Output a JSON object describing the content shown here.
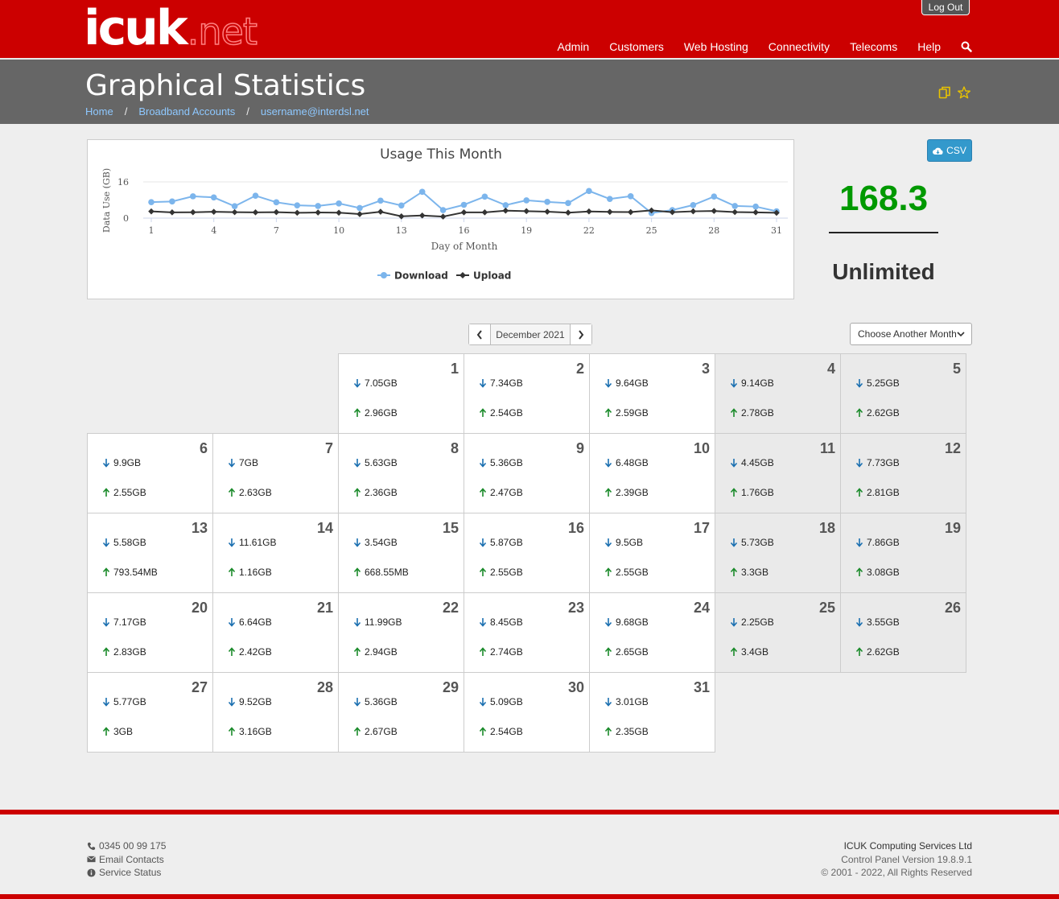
{
  "header": {
    "logo_main": "icuk",
    "logo_suffix": ".net",
    "logout": "Log Out",
    "nav": [
      "Admin",
      "Customers",
      "Web Hosting",
      "Connectivity",
      "Telecoms",
      "Help"
    ],
    "search_icon": "search-icon"
  },
  "title_bar": {
    "title": "Graphical Statistics",
    "breadcrumbs": [
      "Home",
      "Broadband Accounts",
      "username@interdsl.net"
    ]
  },
  "colors": {
    "brand_red": "#cc0000",
    "download": "#7cb5ec",
    "upload": "#333333",
    "total": "#009900"
  },
  "chart_data": {
    "type": "line",
    "title": "Usage This Month",
    "xlabel": "Day of Month",
    "ylabel": "Data Use (GB)",
    "ylim": [
      0,
      16
    ],
    "y_ticks": [
      "0",
      "16"
    ],
    "x_ticks": [
      1,
      4,
      7,
      10,
      13,
      16,
      19,
      22,
      25,
      28,
      31
    ],
    "x": [
      1,
      2,
      3,
      4,
      5,
      6,
      7,
      8,
      9,
      10,
      11,
      12,
      13,
      14,
      15,
      16,
      17,
      18,
      19,
      20,
      21,
      22,
      23,
      24,
      25,
      26,
      27,
      28,
      29,
      30,
      31
    ],
    "series": [
      {
        "name": "Download",
        "values": [
          7.05,
          7.34,
          9.64,
          9.14,
          5.25,
          9.9,
          7,
          5.63,
          5.36,
          6.48,
          4.45,
          7.73,
          5.58,
          11.61,
          3.54,
          5.87,
          9.5,
          5.73,
          7.86,
          7.17,
          6.64,
          11.99,
          8.45,
          9.68,
          2.25,
          3.55,
          5.77,
          9.52,
          5.36,
          5.09,
          3.01
        ]
      },
      {
        "name": "Upload",
        "values": [
          2.96,
          2.54,
          2.59,
          2.78,
          2.62,
          2.55,
          2.63,
          2.36,
          2.47,
          2.39,
          1.76,
          2.81,
          0.79,
          1.16,
          0.67,
          2.55,
          2.55,
          3.3,
          3.08,
          2.83,
          2.42,
          2.94,
          2.74,
          2.65,
          3.4,
          2.62,
          3,
          3.16,
          2.67,
          2.54,
          2.35
        ]
      }
    ],
    "legend": "bottom-center"
  },
  "summary": {
    "csv_label": "CSV",
    "total": "168.3",
    "allowance": "Unlimited"
  },
  "month_nav": {
    "current": "December 2021",
    "select_label": "Choose Another Month"
  },
  "calendar": {
    "days": [
      {
        "day": "1",
        "down": "7.05GB",
        "up": "2.96GB"
      },
      {
        "day": "2",
        "down": "7.34GB",
        "up": "2.54GB"
      },
      {
        "day": "3",
        "down": "9.64GB",
        "up": "2.59GB"
      },
      {
        "day": "4",
        "down": "9.14GB",
        "up": "2.78GB"
      },
      {
        "day": "5",
        "down": "5.25GB",
        "up": "2.62GB"
      },
      {
        "day": "6",
        "down": "9.9GB",
        "up": "2.55GB"
      },
      {
        "day": "7",
        "down": "7GB",
        "up": "2.63GB"
      },
      {
        "day": "8",
        "down": "5.63GB",
        "up": "2.36GB"
      },
      {
        "day": "9",
        "down": "5.36GB",
        "up": "2.47GB"
      },
      {
        "day": "10",
        "down": "6.48GB",
        "up": "2.39GB"
      },
      {
        "day": "11",
        "down": "4.45GB",
        "up": "1.76GB"
      },
      {
        "day": "12",
        "down": "7.73GB",
        "up": "2.81GB"
      },
      {
        "day": "13",
        "down": "5.58GB",
        "up": "793.54MB"
      },
      {
        "day": "14",
        "down": "11.61GB",
        "up": "1.16GB"
      },
      {
        "day": "15",
        "down": "3.54GB",
        "up": "668.55MB"
      },
      {
        "day": "16",
        "down": "5.87GB",
        "up": "2.55GB"
      },
      {
        "day": "17",
        "down": "9.5GB",
        "up": "2.55GB"
      },
      {
        "day": "18",
        "down": "5.73GB",
        "up": "3.3GB"
      },
      {
        "day": "19",
        "down": "7.86GB",
        "up": "3.08GB"
      },
      {
        "day": "20",
        "down": "7.17GB",
        "up": "2.83GB"
      },
      {
        "day": "21",
        "down": "6.64GB",
        "up": "2.42GB"
      },
      {
        "day": "22",
        "down": "11.99GB",
        "up": "2.94GB"
      },
      {
        "day": "23",
        "down": "8.45GB",
        "up": "2.74GB"
      },
      {
        "day": "24",
        "down": "9.68GB",
        "up": "2.65GB"
      },
      {
        "day": "25",
        "down": "2.25GB",
        "up": "3.4GB"
      },
      {
        "day": "26",
        "down": "3.55GB",
        "up": "2.62GB"
      },
      {
        "day": "27",
        "down": "5.77GB",
        "up": "3GB"
      },
      {
        "day": "28",
        "down": "9.52GB",
        "up": "3.16GB"
      },
      {
        "day": "29",
        "down": "5.36GB",
        "up": "2.67GB"
      },
      {
        "day": "30",
        "down": "5.09GB",
        "up": "2.54GB"
      },
      {
        "day": "31",
        "down": "3.01GB",
        "up": "2.35GB"
      }
    ]
  },
  "footer": {
    "phone": "0345 00 99 175",
    "email": "Email Contacts",
    "status": "Service Status",
    "company": "ICUK Computing Services Ltd",
    "version": "Control Panel Version 19.8.9.1",
    "copyright": "© 2001 - 2022, All Rights Reserved"
  }
}
